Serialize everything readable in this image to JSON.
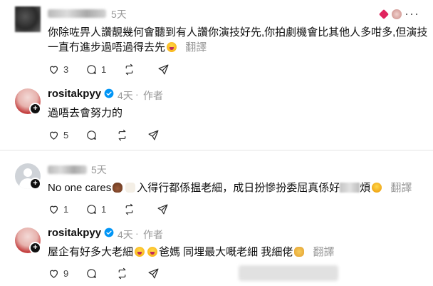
{
  "comments": [
    {
      "id": "c1",
      "avatar": "blurred-avatar",
      "time": "5天",
      "text_line1": "你除咗畀人讚靚幾何會聽到有人讚你演技好先,你拍劇機會比其他人多咁多,但演技",
      "text_line2": "一直冇進步過唔過得去先",
      "translate": "翻譯",
      "like_count": "3",
      "reply_count": "1"
    },
    {
      "id": "c2",
      "avatar": "profile-photo",
      "username": "rositakpyy",
      "verified": true,
      "time": "4天",
      "author_badge": "作者",
      "text": "過唔去會努力的",
      "like_count": "5"
    },
    {
      "id": "c3",
      "avatar": "default-avatar",
      "time": "5天",
      "text_a": "No one cares",
      "text_b": "入得行都係揾老細，成日扮慘扮委屈真係好",
      "text_c": "煩",
      "translate": "翻譯",
      "like_count": "1",
      "reply_count": "1"
    },
    {
      "id": "c4",
      "avatar": "profile-photo",
      "username": "rositakpyy",
      "verified": true,
      "time": "4天",
      "author_badge": "作者",
      "text_a": "屋企有好多大老細",
      "text_b": "爸媽 同埋最大嘅老細 我細佬",
      "translate": "翻譯",
      "like_count": "9"
    }
  ],
  "colors": {
    "text": "#0f0f0f",
    "meta": "#999999",
    "verified": "#0095f6",
    "divider": "#e4e4e4"
  }
}
